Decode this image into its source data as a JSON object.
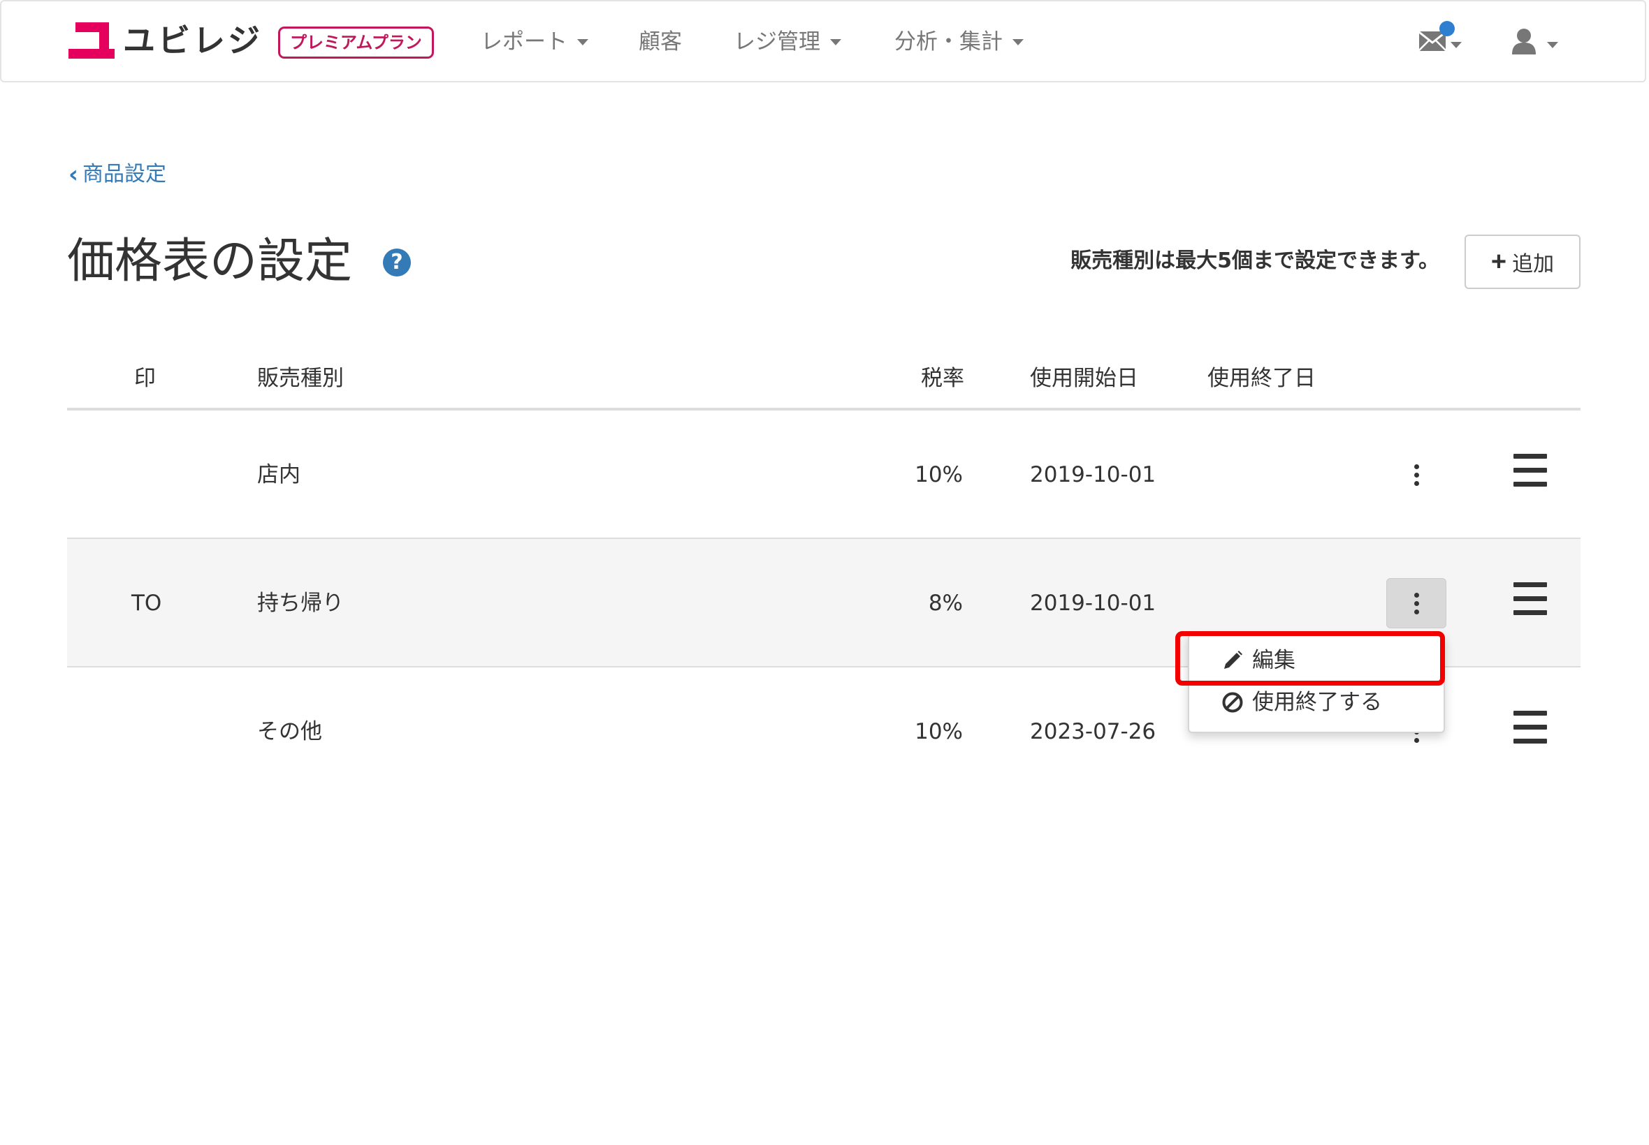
{
  "navbar": {
    "logo_text": "ユビレジ",
    "plan_badge": "プレミアムプラン",
    "menu": [
      {
        "label": "レポート",
        "has_dropdown": true
      },
      {
        "label": "顧客",
        "has_dropdown": false
      },
      {
        "label": "レジ管理",
        "has_dropdown": true
      },
      {
        "label": "分析・集計",
        "has_dropdown": true
      }
    ],
    "icons": [
      "envelope-icon",
      "notification-dot",
      "user-icon"
    ],
    "colors": {
      "brand": "#e4005c",
      "badge": "#c2185b",
      "notification": "#2f7fd0"
    }
  },
  "page": {
    "back_link": "商品設定",
    "title": "価格表の設定",
    "limit_note": "販売種別は最大5個まで設定できます。",
    "add_button": "追加",
    "link_color": "#337ab7"
  },
  "table": {
    "headers": {
      "mark": "印",
      "sales_type": "販売種別",
      "tax_rate": "税率",
      "start_date": "使用開始日",
      "end_date": "使用終了日"
    },
    "rows": [
      {
        "mark": "",
        "sales_type": "店内",
        "tax_rate": "10%",
        "start_date": "2019-10-01",
        "end_date": ""
      },
      {
        "mark": "TO",
        "sales_type": "持ち帰り",
        "tax_rate": "8%",
        "start_date": "2019-10-01",
        "end_date": ""
      },
      {
        "mark": "",
        "sales_type": "その他",
        "tax_rate": "10%",
        "start_date": "2023-07-26",
        "end_date": ""
      }
    ]
  },
  "dropdown": {
    "items": [
      {
        "label": "編集",
        "icon": "pencil-icon"
      },
      {
        "label": "使用終了する",
        "icon": "ban-icon"
      }
    ],
    "highlight_color": "#f20000"
  }
}
